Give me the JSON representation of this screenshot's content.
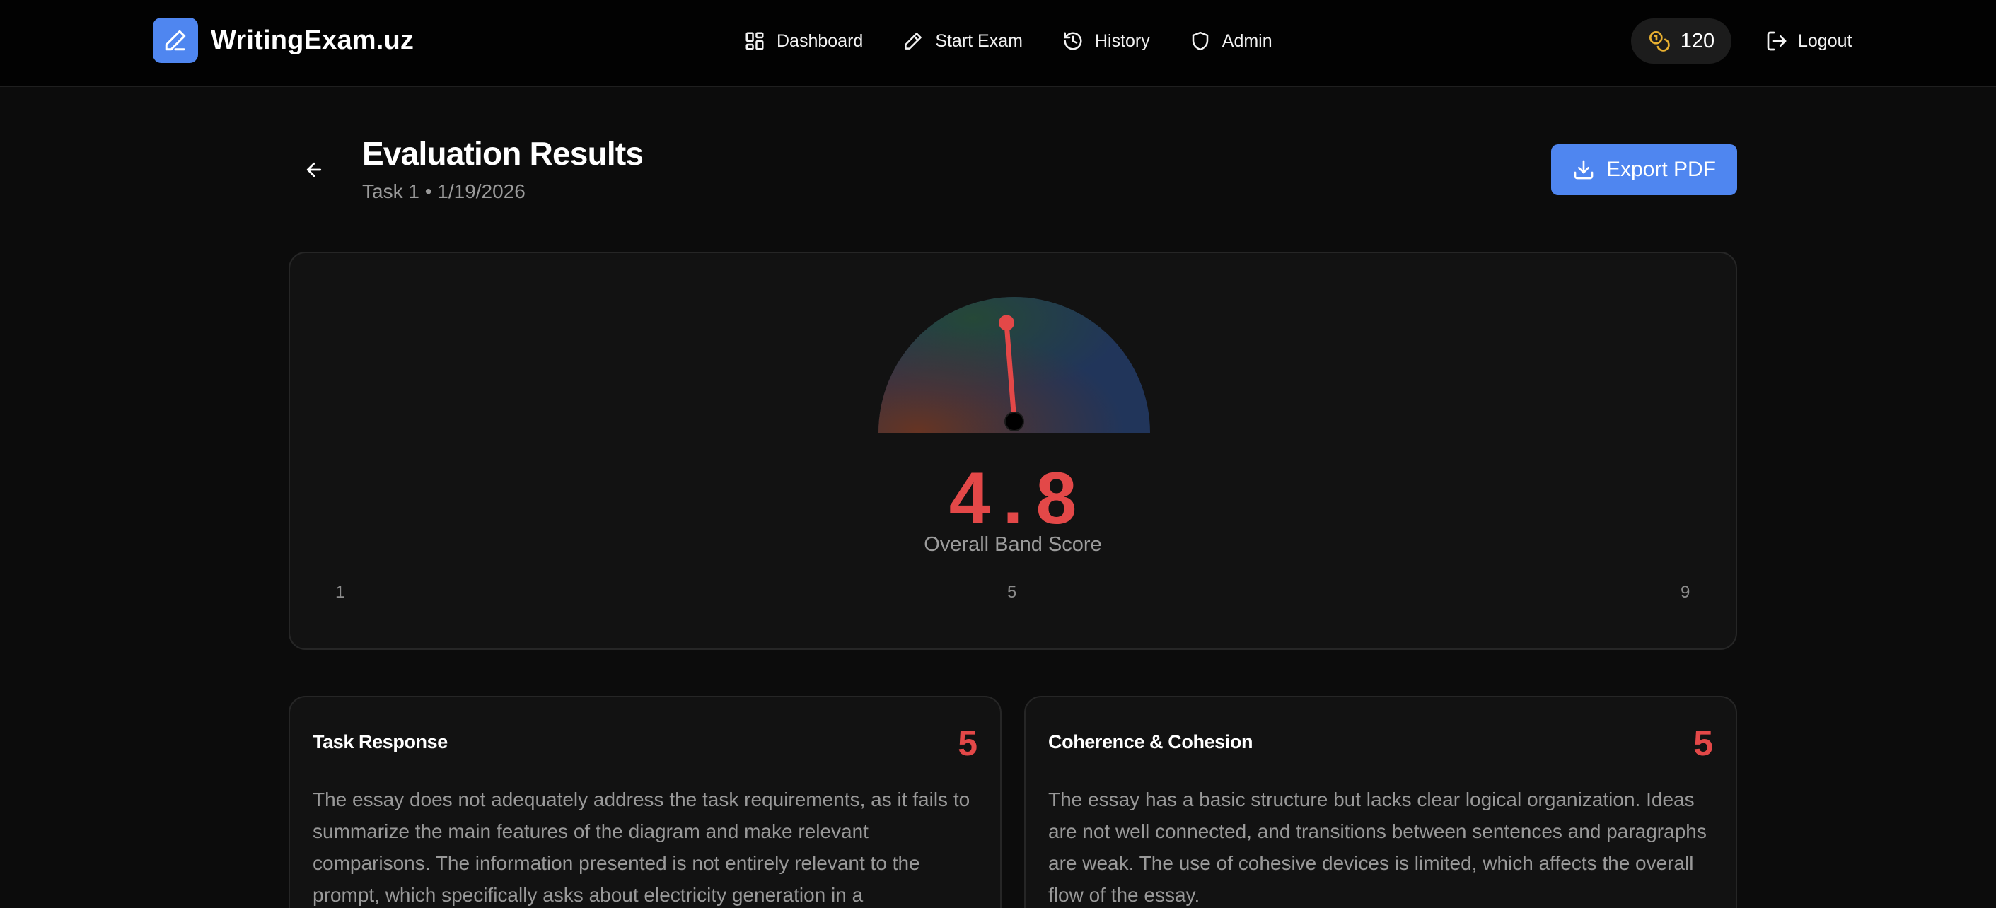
{
  "nav": {
    "brand": "WritingExam.uz",
    "links": [
      {
        "label": "Dashboard",
        "icon": "grid-icon"
      },
      {
        "label": "Start Exam",
        "icon": "pencil-icon"
      },
      {
        "label": "History",
        "icon": "history-icon"
      },
      {
        "label": "Admin",
        "icon": "shield-icon"
      }
    ],
    "credits": "120",
    "logout": "Logout"
  },
  "header": {
    "title": "Evaluation Results",
    "subtitle": "Task 1 • 1/19/2026",
    "export_label": "Export PDF"
  },
  "score": {
    "value": "4.8",
    "value_num": 4.8,
    "label": "Overall Band Score",
    "min": "1",
    "mid": "5",
    "max": "9",
    "needle_color": "#e34848"
  },
  "criteria": [
    {
      "title": "Task Response",
      "score": "5",
      "text": "The essay does not adequately address the task requirements, as it fails to summarize the main features of the diagram and make relevant comparisons. The information presented is not entirely relevant to the prompt, which specifically asks about electricity generation in a"
    },
    {
      "title": "Coherence & Cohesion",
      "score": "5",
      "text": "The essay has a basic structure but lacks clear logical organization. Ideas are not well connected, and transitions between sentences and paragraphs are weak. The use of cohesive devices is limited, which affects the overall flow of the essay."
    }
  ],
  "colors": {
    "accent": "#4f86f0",
    "score": "#e34848",
    "background": "#0c0c0c"
  }
}
